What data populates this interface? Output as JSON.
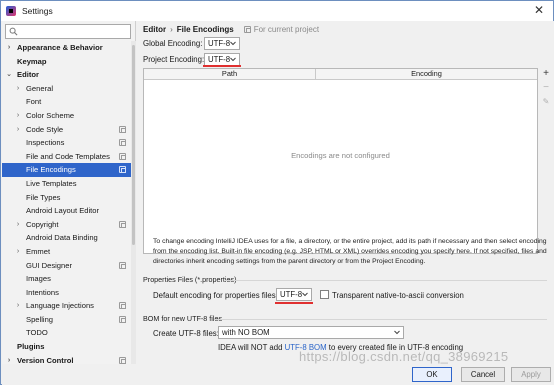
{
  "window": {
    "title": "Settings",
    "close_glyph": "✕"
  },
  "sidebar": {
    "items": [
      {
        "label": "Appearance & Behavior",
        "level": 0,
        "arrow": "›",
        "bold": true
      },
      {
        "label": "Keymap",
        "level": 0,
        "arrow": "",
        "bold": true
      },
      {
        "label": "Editor",
        "level": 0,
        "arrow": "⌄",
        "bold": true
      },
      {
        "label": "General",
        "level": 1,
        "arrow": "›"
      },
      {
        "label": "Font",
        "level": 1,
        "arrow": ""
      },
      {
        "label": "Color Scheme",
        "level": 1,
        "arrow": "›"
      },
      {
        "label": "Code Style",
        "level": 1,
        "arrow": "›",
        "project": true
      },
      {
        "label": "Inspections",
        "level": 1,
        "arrow": "",
        "project": true
      },
      {
        "label": "File and Code Templates",
        "level": 1,
        "arrow": "",
        "project": true
      },
      {
        "label": "File Encodings",
        "level": 1,
        "arrow": "",
        "project": true,
        "selected": true
      },
      {
        "label": "Live Templates",
        "level": 1,
        "arrow": ""
      },
      {
        "label": "File Types",
        "level": 1,
        "arrow": ""
      },
      {
        "label": "Android Layout Editor",
        "level": 1,
        "arrow": ""
      },
      {
        "label": "Copyright",
        "level": 1,
        "arrow": "›",
        "project": true
      },
      {
        "label": "Android Data Binding",
        "level": 1,
        "arrow": ""
      },
      {
        "label": "Emmet",
        "level": 1,
        "arrow": "›"
      },
      {
        "label": "GUI Designer",
        "level": 1,
        "arrow": "",
        "project": true
      },
      {
        "label": "Images",
        "level": 1,
        "arrow": ""
      },
      {
        "label": "Intentions",
        "level": 1,
        "arrow": ""
      },
      {
        "label": "Language Injections",
        "level": 1,
        "arrow": "›",
        "project": true
      },
      {
        "label": "Spelling",
        "level": 1,
        "arrow": "",
        "project": true
      },
      {
        "label": "TODO",
        "level": 1,
        "arrow": ""
      },
      {
        "label": "Plugins",
        "level": 0,
        "arrow": "",
        "bold": true
      },
      {
        "label": "Version Control",
        "level": 0,
        "arrow": "›",
        "bold": true,
        "project": true
      }
    ]
  },
  "breadcrumb": {
    "parent": "Editor",
    "separator": "›",
    "current": "File Encodings",
    "note": "For current project"
  },
  "global_encoding": {
    "label": "Global Encoding:",
    "value": "UTF-8"
  },
  "project_encoding": {
    "label": "Project Encoding:",
    "value": "UTF-8"
  },
  "table": {
    "columns": [
      "Path",
      "Encoding"
    ],
    "empty_message": "Encodings are not configured"
  },
  "tools": {
    "add": "+",
    "remove": "−",
    "edit": "✎"
  },
  "description": "To change encoding IntelliJ IDEA uses for a file, a directory, or the entire project, add its path if necessary and then select encoding from the encoding list. Built-in file encoding (e.g. JSP, HTML or XML) overrides encoding you specify here. If not specified, files and directories inherit encoding settings from the parent directory or from the Project Encoding.",
  "properties": {
    "section_title": "Properties Files (*.properties)",
    "default_label": "Default encoding for properties files:",
    "default_value": "UTF-8",
    "native_ascii_label": "Transparent native-to-ascii conversion",
    "native_ascii_checked": false
  },
  "bom": {
    "section_title": "BOM for new UTF-8 files",
    "create_label": "Create UTF-8 files:",
    "create_value": "with NO BOM",
    "note_prefix": "IDEA will NOT add",
    "note_link": "UTF-8 BOM",
    "note_suffix": "to every created file in UTF-8 encoding"
  },
  "buttons": {
    "ok": "OK",
    "cancel": "Cancel",
    "apply": "Apply"
  },
  "watermark": "https://blog.csdn.net/qq_38969215"
}
